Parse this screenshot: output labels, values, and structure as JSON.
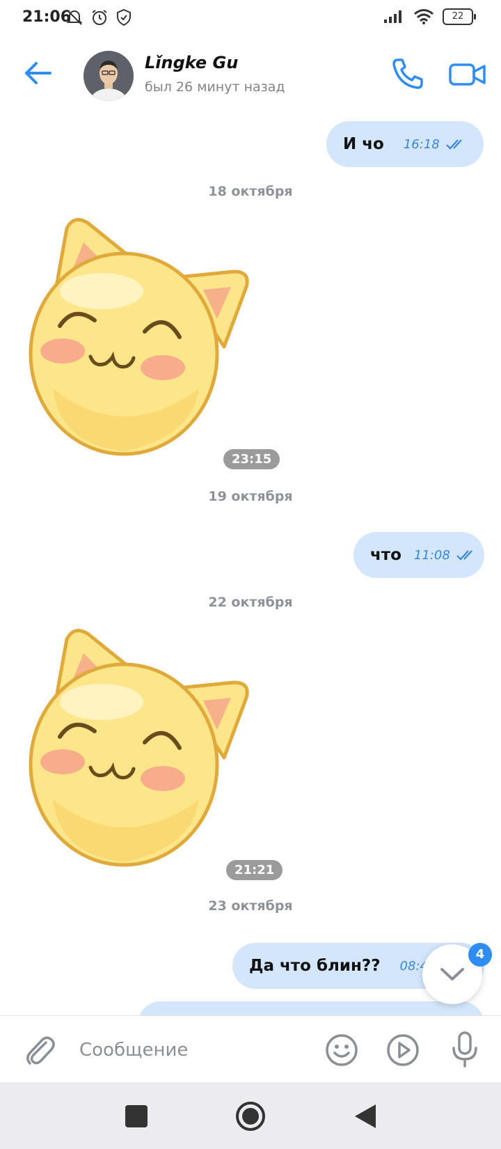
{
  "status_bar": {
    "time": "21:06",
    "battery": "22",
    "icons_left": [
      "bell-off-icon",
      "alarm-icon",
      "shield-icon"
    ],
    "icons_right": [
      "signal-icon",
      "wifi-icon",
      "battery-icon"
    ]
  },
  "header": {
    "contact_name": "Lǐngke Gu",
    "last_seen": "был 26 минут назад",
    "back_icon": "back-arrow-icon",
    "call_icon": "phone-icon",
    "video_icon": "video-icon"
  },
  "messages": [
    {
      "type": "outgoing",
      "text": "И чо",
      "time": "16:18",
      "read": true
    },
    {
      "type": "date",
      "text": "18 октября"
    },
    {
      "type": "sticker",
      "time": "23:15"
    },
    {
      "type": "date",
      "text": "19 октября"
    },
    {
      "type": "outgoing",
      "text": "что",
      "time": "11:08",
      "read": true
    },
    {
      "type": "date",
      "text": "22 октября"
    },
    {
      "type": "sticker",
      "time": "21:21"
    },
    {
      "type": "date",
      "text": "23 октября"
    },
    {
      "type": "outgoing",
      "text": "Да что блин??",
      "time": "08:4",
      "read": true
    }
  ],
  "scroll_button": {
    "badge": "4",
    "icon": "chevron-down-icon"
  },
  "composer": {
    "placeholder": "Сообщение",
    "icons": [
      "paperclip-icon",
      "emoji-icon",
      "gif-icon",
      "microphone-icon"
    ]
  },
  "colors": {
    "accent": "#2f8cf0",
    "bubble_out": "#d3e6fc",
    "time_text": "#3a86d6"
  }
}
